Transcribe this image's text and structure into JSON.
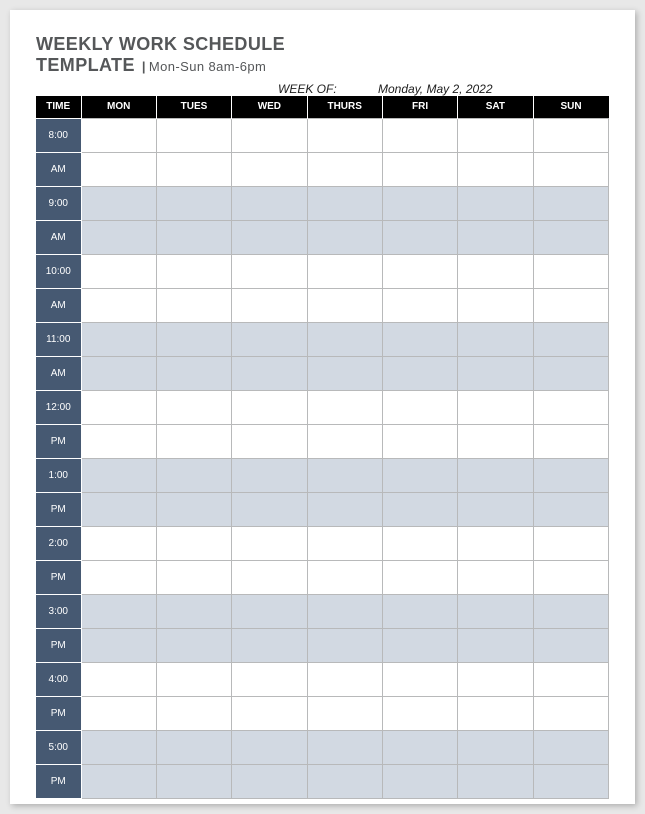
{
  "title": {
    "line1": "WEEKLY WORK SCHEDULE",
    "line2": "TEMPLATE",
    "pipe": "|",
    "subtitle": "Mon-Sun 8am-6pm"
  },
  "weekof": {
    "label": "WEEK OF:",
    "value": "Monday, May 2, 2022"
  },
  "headers": {
    "time": "TIME",
    "days": [
      "MON",
      "TUES",
      "WED",
      "THURS",
      "FRI",
      "SAT",
      "SUN"
    ]
  },
  "time_slots": [
    {
      "hour": "8:00",
      "period": "AM",
      "shaded": false
    },
    {
      "hour": "9:00",
      "period": "AM",
      "shaded": true
    },
    {
      "hour": "10:00",
      "period": "AM",
      "shaded": false
    },
    {
      "hour": "11:00",
      "period": "AM",
      "shaded": true
    },
    {
      "hour": "12:00",
      "period": "PM",
      "shaded": false
    },
    {
      "hour": "1:00",
      "period": "PM",
      "shaded": true
    },
    {
      "hour": "2:00",
      "period": "PM",
      "shaded": false
    },
    {
      "hour": "3:00",
      "period": "PM",
      "shaded": true
    },
    {
      "hour": "4:00",
      "period": "PM",
      "shaded": false
    },
    {
      "hour": "5:00",
      "period": "PM",
      "shaded": true
    }
  ]
}
